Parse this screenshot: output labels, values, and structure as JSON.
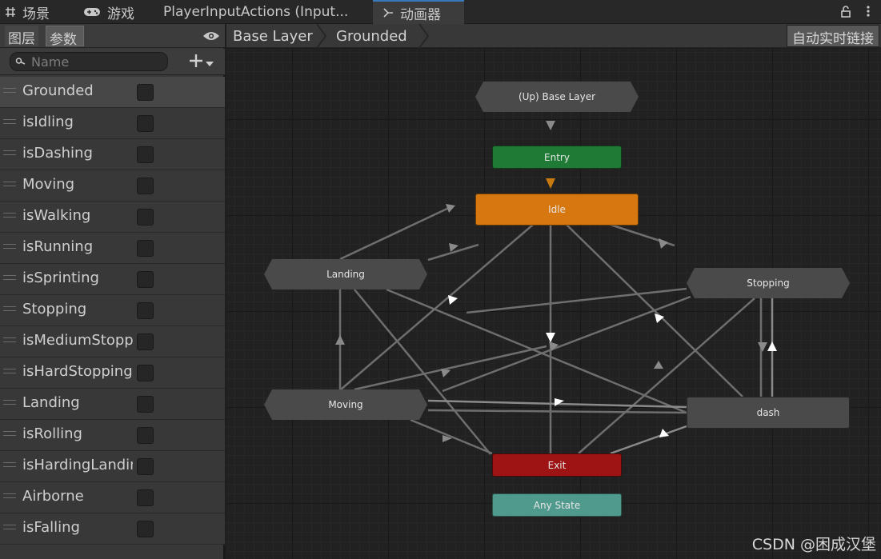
{
  "tabs": [
    {
      "label": "场景",
      "icon": "grid-icon"
    },
    {
      "label": "游戏",
      "icon": "gamepad-icon"
    },
    {
      "label": "PlayerInputActions (Input..."
    },
    {
      "label": "动画器",
      "icon": "animator-icon",
      "active": true
    }
  ],
  "left_panel": {
    "tab_layers": "图层",
    "tab_params": "参数",
    "search_placeholder": "Name",
    "parameters": [
      {
        "name": "Grounded",
        "checked": false
      },
      {
        "name": "isIdling",
        "checked": false
      },
      {
        "name": "isDashing",
        "checked": false
      },
      {
        "name": "Moving",
        "checked": false
      },
      {
        "name": "isWalking",
        "checked": false
      },
      {
        "name": "isRunning",
        "checked": false
      },
      {
        "name": "isSprinting",
        "checked": false
      },
      {
        "name": "Stopping",
        "checked": false
      },
      {
        "name": "isMediumStopping",
        "checked": false
      },
      {
        "name": "isHardStopping",
        "checked": false
      },
      {
        "name": "Landing",
        "checked": false
      },
      {
        "name": "isRolling",
        "checked": false
      },
      {
        "name": "isHardingLanding",
        "checked": false
      },
      {
        "name": "Airborne",
        "checked": false
      },
      {
        "name": "isFalling",
        "checked": false
      }
    ]
  },
  "breadcrumb": [
    "Base Layer",
    "Grounded"
  ],
  "autolink_label": "自动实时链接",
  "graph": {
    "nodes": {
      "up": "(Up) Base Layer",
      "entry": "Entry",
      "idle": "Idle",
      "landing": "Landing",
      "stopping": "Stopping",
      "moving": "Moving",
      "dash": "dash",
      "exit": "Exit",
      "any": "Any State"
    },
    "colors": {
      "entry": "#1e7a34",
      "idle": "#d6780f",
      "exit": "#9e1414",
      "any_state": "#4f9a8d",
      "state": "#4a4a4a"
    }
  },
  "watermark": "CSDN @困成汉堡"
}
